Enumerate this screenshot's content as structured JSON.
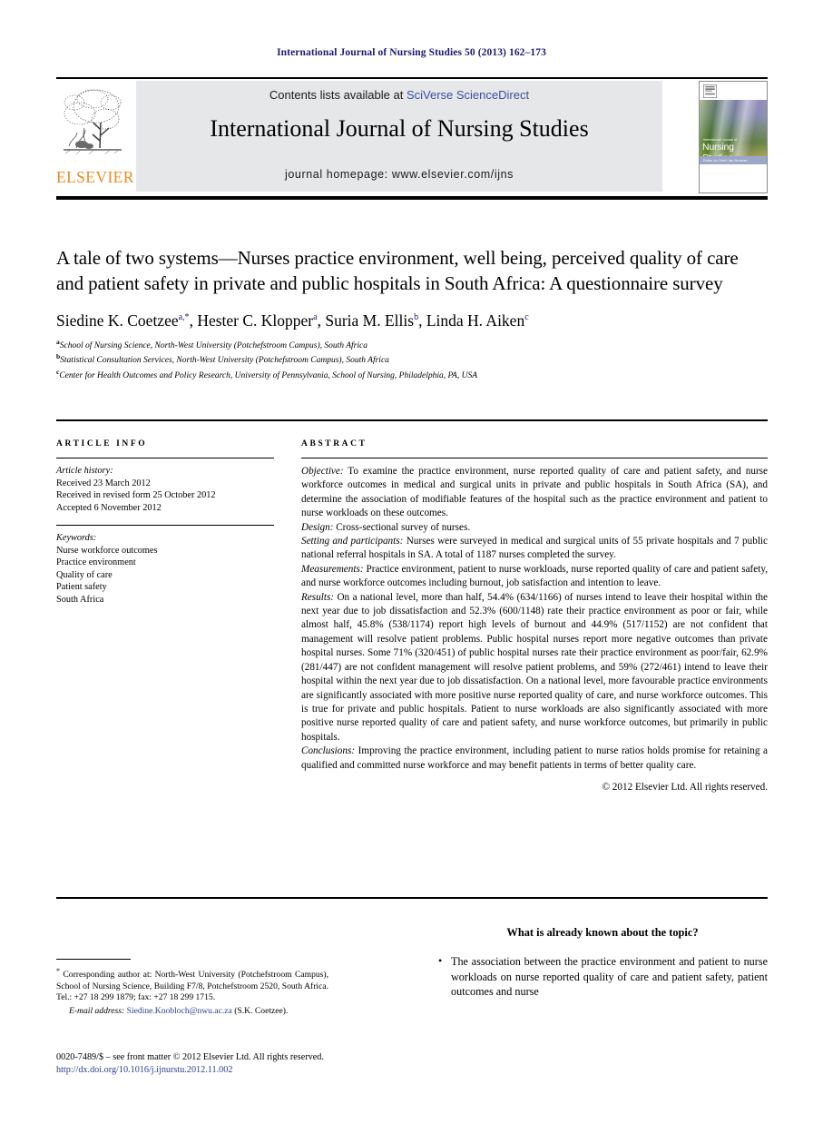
{
  "running_head": "International Journal of Nursing Studies 50 (2013) 162–173",
  "masthead": {
    "contents_prefix": "Contents lists available at ",
    "contents_link": "SciVerse ScienceDirect",
    "journal_name": "International Journal of Nursing Studies",
    "homepage": "journal homepage: www.elsevier.com/ijns",
    "publisher_wordmark": "ELSEVIER",
    "publisher_accent": "#ec8b24",
    "link_color": "#3a4fa0",
    "cover": {
      "overline": "International Journal of",
      "title": "Nursing Studies",
      "strip": "Editor-in-Chief: Ian Norman"
    }
  },
  "article": {
    "title": "A tale of two systems—Nurses practice environment, well being, perceived quality of care and patient safety in private and public hospitals in South Africa: A questionnaire survey",
    "authors_html": "Siedine K. Coetzee<sup>a,*</sup>, Hester C. Klopper<sup>a</sup>, Suria M. Ellis<sup>b</sup>, Linda H. Aiken<sup>c</sup>",
    "affiliations": [
      {
        "mark": "a",
        "text": "School of Nursing Science, North-West University (Potchefstroom Campus), South Africa"
      },
      {
        "mark": "b",
        "text": "Statistical Consultation Services, North-West University (Potchefstroom Campus), South Africa"
      },
      {
        "mark": "c",
        "text": "Center for Health Outcomes and Policy Research, University of Pennsylvania, School of Nursing, Philadelphia, PA, USA"
      }
    ]
  },
  "article_info": {
    "heading": "ARTICLE INFO",
    "history_label": "Article history:",
    "history": [
      "Received 23 March 2012",
      "Received in revised form 25 October 2012",
      "Accepted 6 November 2012"
    ],
    "keywords_label": "Keywords:",
    "keywords": [
      "Nurse workforce outcomes",
      "Practice environment",
      "Quality of care",
      "Patient safety",
      "South Africa"
    ]
  },
  "abstract": {
    "heading": "ABSTRACT",
    "sections": [
      {
        "label": "Objective:",
        "text": "To examine the practice environment, nurse reported quality of care and patient safety, and nurse workforce outcomes in medical and surgical units in private and public hospitals in South Africa (SA), and determine the association of modifiable features of the hospital such as the practice environment and patient to nurse workloads on these outcomes."
      },
      {
        "label": "Design:",
        "text": "Cross-sectional survey of nurses."
      },
      {
        "label": "Setting and participants:",
        "text": "Nurses were surveyed in medical and surgical units of 55 private hospitals and 7 public national referral hospitals in SA. A total of 1187 nurses completed the survey."
      },
      {
        "label": "Measurements:",
        "text": "Practice environment, patient to nurse workloads, nurse reported quality of care and patient safety, and nurse workforce outcomes including burnout, job satisfaction and intention to leave."
      },
      {
        "label": "Results:",
        "text": "On a national level, more than half, 54.4% (634/1166) of nurses intend to leave their hospital within the next year due to job dissatisfaction and 52.3% (600/1148) rate their practice environment as poor or fair, while almost half, 45.8% (538/1174) report high levels of burnout and 44.9% (517/1152) are not confident that management will resolve patient problems. Public hospital nurses report more negative outcomes than private hospital nurses. Some 71% (320/451) of public hospital nurses rate their practice environment as poor/fair, 62.9% (281/447) are not confident management will resolve patient problems, and 59% (272/461) intend to leave their hospital within the next year due to job dissatisfaction. On a national level, more favourable practice environments are significantly associated with more positive nurse reported quality of care, and nurse workforce outcomes. This is true for private and public hospitals. Patient to nurse workloads are also significantly associated with more positive nurse reported quality of care and patient safety, and nurse workforce outcomes, but primarily in public hospitals."
      },
      {
        "label": "Conclusions:",
        "text": "Improving the practice environment, including patient to nurse ratios holds promise for retaining a qualified and committed nurse workforce and may benefit patients in terms of better quality care."
      }
    ],
    "copyright": "© 2012 Elsevier Ltd. All rights reserved."
  },
  "footnotes": {
    "corresponding": "Corresponding author at: North-West University (Potchefstroom Campus), School of Nursing Science, Building F7/8, Potchefstroom 2520, South Africa. Tel.: +27 18 299 1879; fax: +27 18 299 1715.",
    "email_label": "E-mail address:",
    "email": "Siedine.Knobloch@nwu.ac.za",
    "email_owner": "(S.K. Coetzee).",
    "issn_line": "0020-7489/$ – see front matter © 2012 Elsevier Ltd. All rights reserved.",
    "doi": "http://dx.doi.org/10.1016/j.ijnurstu.2012.11.002"
  },
  "known_box": {
    "heading": "What is already known about the topic?",
    "items": [
      "The association between the practice environment and patient to nurse workloads on nurse reported quality of care and patient safety, patient outcomes and nurse"
    ]
  }
}
